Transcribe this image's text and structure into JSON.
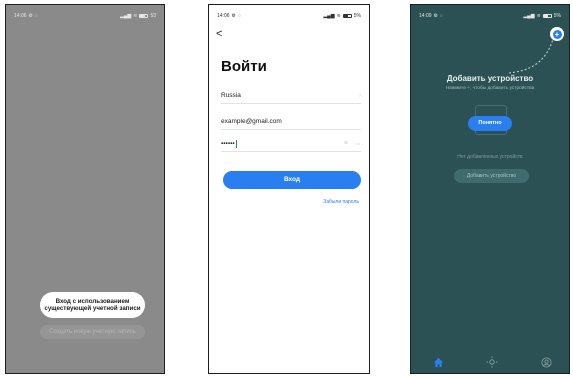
{
  "screens": {
    "s1": {
      "status": {
        "time": "14:06",
        "battery": "53"
      },
      "primary_button": "Вход с использованием существующей учетной записи",
      "secondary_button": "Создать новую учетную запись"
    },
    "s2": {
      "status": {
        "time": "14:06",
        "battery": "5%"
      },
      "back": "<",
      "title": "Войти",
      "country": "Russia",
      "email": "example@gmail.com",
      "password_mask": "••••••",
      "login_button": "Вход",
      "forgot_link": "Забыли пароль"
    },
    "s3": {
      "status": {
        "time": "14:09",
        "battery": "5%"
      },
      "title": "Добавить устройство",
      "subtitle": "Нажмите +, чтобы добавить устройства",
      "understood_button": "Понятно",
      "no_devices": "Нет добавленных устройств",
      "add_device_button": "Добавить устройство",
      "add_icon": "+"
    }
  },
  "icons": {
    "home": "home-icon",
    "scenes": "sun-icon",
    "profile": "profile-icon"
  },
  "colors": {
    "accent": "#2a7ff0",
    "overlay_gray": "#8a8a8a",
    "teal_overlay": "#2c5155"
  }
}
